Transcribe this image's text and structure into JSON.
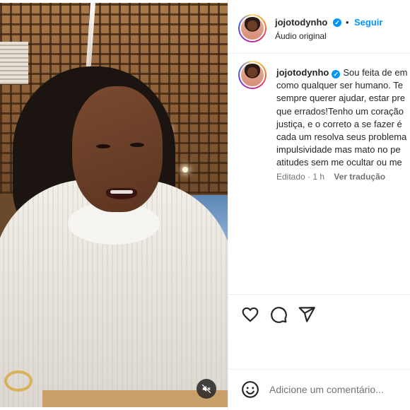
{
  "header": {
    "username": "jojotodynho",
    "separator": "•",
    "follow_label": "Seguir",
    "audio_label": "Áudio original"
  },
  "caption": {
    "username": "jojotodynho",
    "lines": [
      "Sou feita de em",
      "como qualquer ser humano. Te",
      "sempre querer ajudar, estar pre",
      "que errados!Tenho um coração",
      "justiça, e o correto a se fazer é",
      "cada um resolva seus problema",
      "impulsividade mas mato no pe",
      "atitudes sem me ocultar ou me"
    ],
    "edited_label": "Editado",
    "time_separator": " · ",
    "time": "1 h",
    "translation_label": "Ver tradução"
  },
  "actions": {
    "like_icon": "heart-icon",
    "comment_icon": "comment-icon",
    "share_icon": "share-icon"
  },
  "comment_box": {
    "emoji_icon": "emoji-icon",
    "placeholder": "Adicione um comentário..."
  },
  "media": {
    "mute_icon": "speaker-muted-icon"
  },
  "colors": {
    "accent": "#0095f6",
    "text": "#262626",
    "secondary_text": "#737373",
    "divider": "#efefef"
  }
}
